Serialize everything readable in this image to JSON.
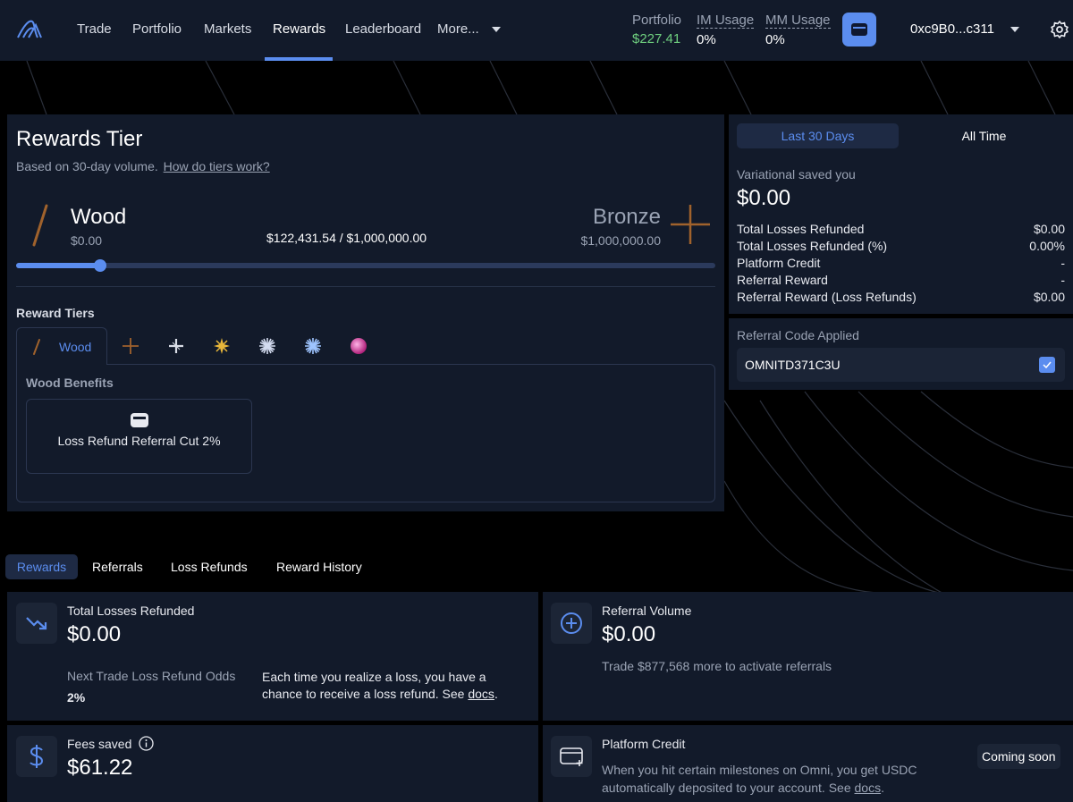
{
  "nav": {
    "items": [
      "Trade",
      "Portfolio",
      "Markets",
      "Rewards",
      "Leaderboard",
      "More..."
    ],
    "active": "Rewards",
    "portfolio_label": "Portfolio",
    "portfolio_value": "$227.41",
    "im_label": "IM Usage",
    "im_value": "0%",
    "mm_label": "MM Usage",
    "mm_value": "0%",
    "address": "0xc9B0...c311"
  },
  "tier": {
    "title": "Rewards Tier",
    "subtitle": "Based on 30-day volume.",
    "subtitle_link": "How do tiers work?",
    "current_name": "Wood",
    "current_amount": "$0.00",
    "progress_text": "$122,431.54 / $1,000,000.00",
    "progress_fraction": 0.12,
    "next_name": "Bronze",
    "next_amount": "$1,000,000.00",
    "reward_tiers_label": "Reward Tiers",
    "active_tab": "Wood",
    "benefits_title": "Wood Benefits",
    "benefit_label": "Loss Refund Referral Cut 2%"
  },
  "summary": {
    "tab_30": "Last 30 Days",
    "tab_all": "All Time",
    "saved_label": "Variational saved you",
    "saved_value": "$0.00",
    "rows": [
      {
        "label": "Total Losses Refunded",
        "value": "$0.00"
      },
      {
        "label": "Total Losses Refunded (%)",
        "value": "0.00%"
      },
      {
        "label": "Platform Credit",
        "value": "-"
      },
      {
        "label": "Referral Reward",
        "value": "-"
      },
      {
        "label": "Referral Reward (Loss Refunds)",
        "value": "$0.00"
      }
    ]
  },
  "referral": {
    "label": "Referral Code Applied",
    "code": "OMNITD371C3U"
  },
  "tabs": [
    "Rewards",
    "Referrals",
    "Loss Refunds",
    "Reward History"
  ],
  "cards": {
    "losses": {
      "title": "Total Losses Refunded",
      "value": "$0.00",
      "odds_label": "Next Trade Loss Refund Odds",
      "odds_value": "2%",
      "desc1": "Each time you realize a loss, you have a",
      "desc2": "chance to receive a loss refund. See",
      "desc_link": "docs",
      "desc_end": "."
    },
    "referral_volume": {
      "title": "Referral Volume",
      "value": "$0.00",
      "desc": "Trade $877,568 more to activate referrals"
    },
    "fees": {
      "title": "Fees saved",
      "value": "$61.22"
    },
    "platform_credit": {
      "title": "Platform Credit",
      "desc1": "When you hit certain milestones on Omni, you get USDC",
      "desc2": "automatically deposited to your account. See",
      "desc_link": "docs",
      "desc_end": ".",
      "badge": "Coming soon"
    }
  },
  "colors": {
    "accent": "#5b8def",
    "positive": "#6fcf7f",
    "wood": "#a0622c",
    "panel": "#121a2a"
  }
}
